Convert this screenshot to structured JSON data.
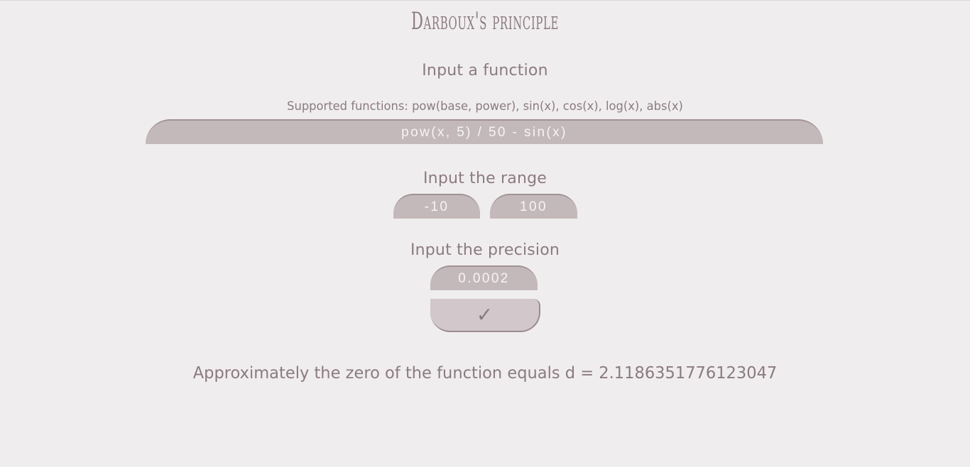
{
  "title": "Darboux's principle",
  "function_section": {
    "heading": "Input a function",
    "hint": "Supported functions: pow(base, power), sin(x), cos(x), log(x), abs(x)",
    "value": "pow(x, 5) / 50 - sin(x)"
  },
  "range_section": {
    "heading": "Input the range",
    "min_value": "-10",
    "max_value": "100"
  },
  "precision_section": {
    "heading": "Input the precision",
    "value": "0.0002"
  },
  "submit": {
    "label": "✓",
    "icon": "checkmark-icon"
  },
  "result": {
    "text": "Approximately the zero of the function equals d = 2.1186351776123047"
  }
}
